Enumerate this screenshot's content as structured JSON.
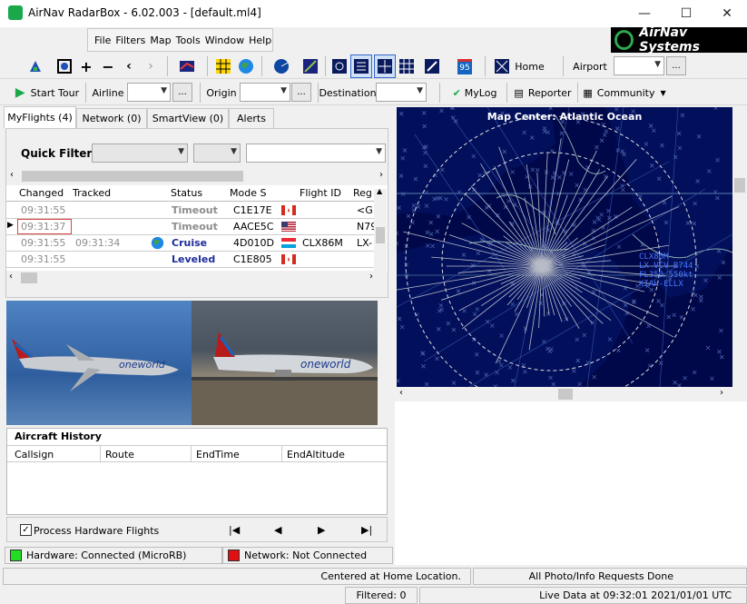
{
  "window": {
    "title": "AirNav RadarBox - 6.02.003 - [default.ml4]"
  },
  "menu": [
    "File",
    "Filters",
    "Map",
    "Tools",
    "Window",
    "Help"
  ],
  "logo_text": "AirNav Systems",
  "toolbar1": {
    "home_label": "Home",
    "airport_label": "Airport",
    "airport_value": "",
    "zoom_badge": "95"
  },
  "toolbar2": {
    "start_tour": "Start Tour",
    "airline_label": "Airline",
    "origin_label": "Origin",
    "destination_label": "Destination",
    "mylog": "MyLog",
    "reporter": "Reporter",
    "community": "Community"
  },
  "tabs": [
    "MyFlights (4)",
    "Network (0)",
    "SmartView (0)",
    "Alerts"
  ],
  "quick_filter": {
    "label": "Quick Filter"
  },
  "grid": {
    "columns": [
      "Changed",
      "Tracked",
      "Status",
      "Mode S",
      "Flight ID",
      "Reg"
    ],
    "rows": [
      {
        "changed": "09:31:55",
        "tracked": "",
        "status": "Timeout",
        "mode_s": "C1E17E",
        "flag": "ca",
        "flight_id": "",
        "reg": "<G"
      },
      {
        "changed": "09:31:37",
        "tracked": "",
        "status": "Timeout",
        "mode_s": "AACE5C",
        "flag": "us",
        "flight_id": "",
        "reg": "N79"
      },
      {
        "changed": "09:31:55",
        "tracked": "09:31:34",
        "status": "Cruise",
        "mode_s": "4D010D",
        "flag": "lu",
        "flight_id": "CLX86M",
        "reg": "LX-"
      },
      {
        "changed": "09:31:55",
        "tracked": "",
        "status": "Leveled",
        "mode_s": "C1E805",
        "flag": "ca",
        "flight_id": "",
        "reg": ""
      }
    ]
  },
  "history": {
    "title": "Aircraft History",
    "columns": [
      "Callsign",
      "Route",
      "EndTime",
      "EndAltitude"
    ]
  },
  "process_hw": "Process Hardware Flights",
  "playback": [
    "|◀",
    "◀",
    "▶",
    "▶|"
  ],
  "hw_status": "Hardware: Connected (MicroRB)",
  "net_status": "Network: Not Connected",
  "map": {
    "caption": "Map Center: Atlantic Ocean",
    "label_lines": [
      "CLX86M",
      "LX-VCV B744",
      "FL350 550kt",
      "KIAH-ELLX"
    ]
  },
  "status_center": "Centered at Home Location.",
  "status_photo": "All Photo/Info Requests Done",
  "filtered": "Filtered: 0",
  "live_data": "Live Data at 09:32:01 2021/01/01 UTC"
}
